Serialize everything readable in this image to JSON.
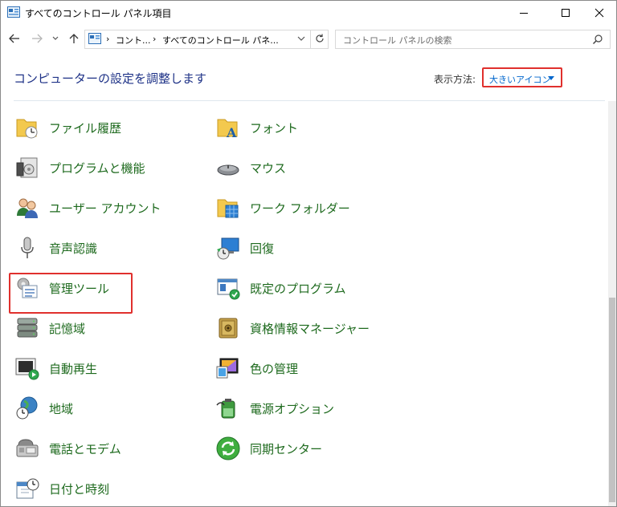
{
  "window": {
    "title": "すべてのコントロール パネル項目",
    "controls": {
      "minimize": "—",
      "maximize": "☐",
      "close": "✕"
    }
  },
  "address": {
    "crumbs": [
      "コント...",
      "すべてのコントロール パネ..."
    ],
    "separator": "›"
  },
  "search": {
    "placeholder": "コントロール パネルの検索"
  },
  "header": {
    "title": "コンピューターの設定を調整します",
    "view_by_label": "表示方法:",
    "view_by_value": "大きいアイコン"
  },
  "items_left": [
    {
      "label": "ファイル履歴",
      "icon": "file-history-icon"
    },
    {
      "label": "プログラムと機能",
      "icon": "programs-features-icon"
    },
    {
      "label": "ユーザー アカウント",
      "icon": "user-accounts-icon"
    },
    {
      "label": "音声認識",
      "icon": "microphone-icon"
    },
    {
      "label": "管理ツール",
      "icon": "admin-tools-icon"
    },
    {
      "label": "記憶域",
      "icon": "storage-icon"
    },
    {
      "label": "自動再生",
      "icon": "autoplay-icon"
    },
    {
      "label": "地域",
      "icon": "globe-clock-icon"
    },
    {
      "label": "電話とモデム",
      "icon": "fax-icon"
    },
    {
      "label": "日付と時刻",
      "icon": "calendar-clock-icon"
    }
  ],
  "items_right": [
    {
      "label": "フォント",
      "icon": "font-folder-icon"
    },
    {
      "label": "マウス",
      "icon": "mouse-icon"
    },
    {
      "label": "ワーク フォルダー",
      "icon": "work-folders-icon"
    },
    {
      "label": "回復",
      "icon": "recovery-icon"
    },
    {
      "label": "既定のプログラム",
      "icon": "default-programs-icon"
    },
    {
      "label": "資格情報マネージャー",
      "icon": "credential-vault-icon"
    },
    {
      "label": "色の管理",
      "icon": "color-management-icon"
    },
    {
      "label": "電源オプション",
      "icon": "power-options-icon"
    },
    {
      "label": "同期センター",
      "icon": "sync-center-icon"
    }
  ],
  "colors": {
    "item_text": "#1e6a1e",
    "heading": "#1e3287",
    "link": "#0066cc",
    "highlight": "#e0302d"
  }
}
